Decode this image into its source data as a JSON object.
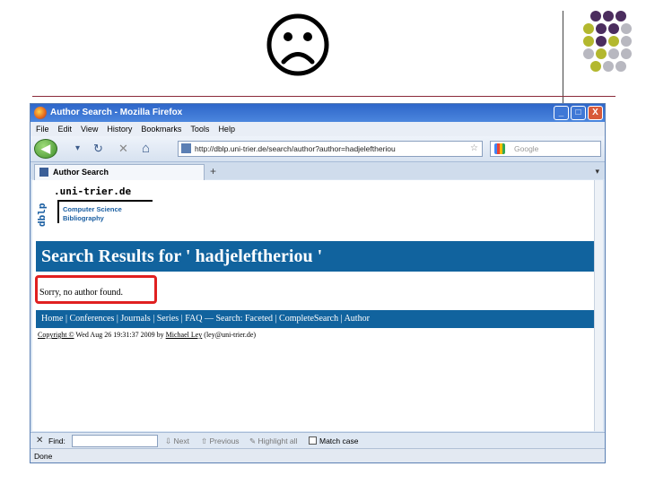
{
  "window": {
    "title": "Author Search - Mozilla Firefox",
    "buttons": {
      "minimize": "_",
      "maximize": "□",
      "close": "X"
    }
  },
  "menu": [
    "File",
    "Edit",
    "View",
    "History",
    "Bookmarks",
    "Tools",
    "Help"
  ],
  "toolbar": {
    "back": "◀",
    "dropdown": "▾",
    "reload": "↻",
    "stop": "✕",
    "home": "⌂",
    "url": "http://dblp.uni-trier.de/search/author?author=hadjeleftheriou",
    "url_star": "☆",
    "search_placeholder": "Google"
  },
  "tabs": {
    "active_label": "Author Search",
    "new_tab": "+",
    "scroll": "▾"
  },
  "page": {
    "logo_vertical": "dblp",
    "logo_domain": ".uni-trier.de",
    "logo_sub_1": "Computer Science",
    "logo_sub_2": "Bibliography",
    "results_title": "Search Results for ' hadjeleftheriou '",
    "no_result": "Sorry, no author found.",
    "footer_nav": "Home | Conferences | Journals | Series | FAQ — Search: Faceted | CompleteSearch | Author",
    "copyright_prefix": "Copyright ©",
    "copyright_date": "Wed Aug 26 19:31:37 2009 by",
    "copyright_name": "Michael Ley",
    "copyright_email": "(ley@uni-trier.de)"
  },
  "findbar": {
    "close": "✕",
    "label": "Find:",
    "next": "Next",
    "previous": "Previous",
    "highlight": "Highlight all",
    "match_case": "Match case"
  },
  "status": {
    "text": "Done"
  },
  "colors": {
    "dblp_blue": "#11639e",
    "highlight_red": "#e02020",
    "dot_purple": "#4b2d5e",
    "dot_lime": "#b3b82e",
    "dot_gray": "#b8b8c0"
  }
}
